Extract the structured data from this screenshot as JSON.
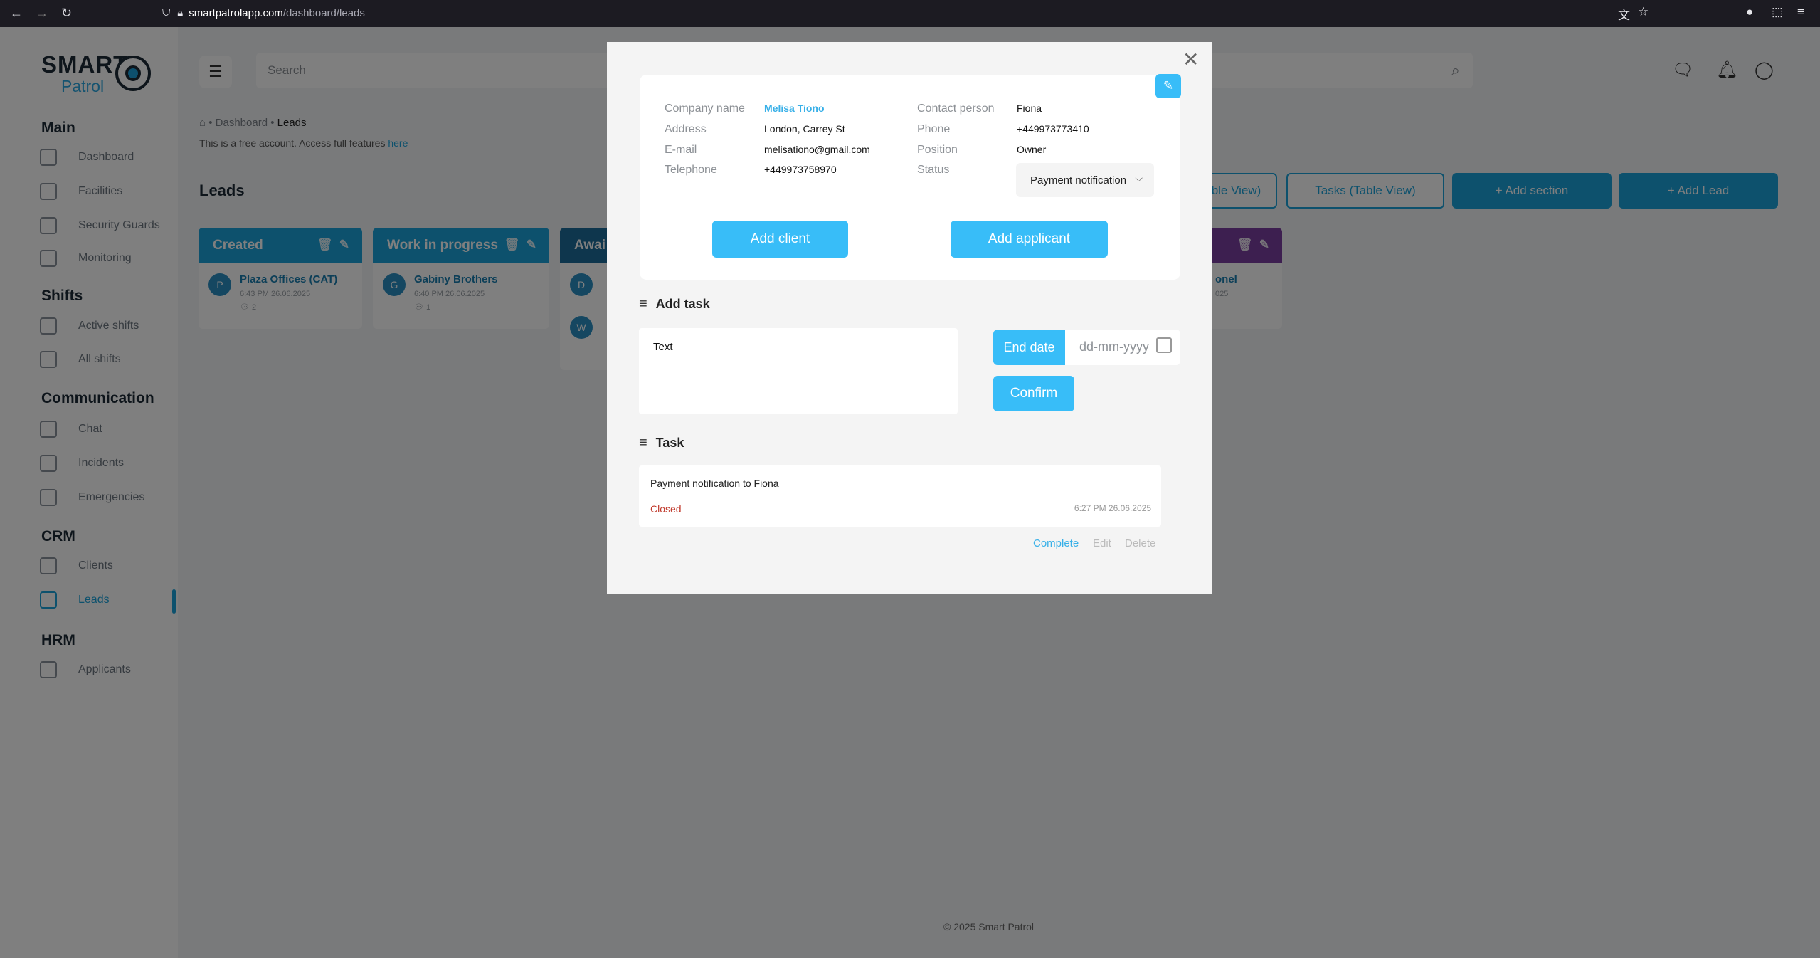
{
  "browser": {
    "url_host": "smartpatrolapp.com",
    "url_path": "/dashboard/leads"
  },
  "logo": {
    "word1": "SMART",
    "word2": "Patrol"
  },
  "sidebar": {
    "sections": [
      {
        "title": "Main",
        "items": [
          {
            "label": "Dashboard",
            "icon": "dashboard-icon"
          },
          {
            "label": "Facilities",
            "icon": "building-icon"
          },
          {
            "label": "Security Guards",
            "icon": "guard-icon"
          },
          {
            "label": "Monitoring",
            "icon": "monitor-icon"
          }
        ]
      },
      {
        "title": "Shifts",
        "items": [
          {
            "label": "Active shifts",
            "icon": "clock-user-icon"
          },
          {
            "label": "All shifts",
            "icon": "calendar-icon"
          }
        ]
      },
      {
        "title": "Communication",
        "items": [
          {
            "label": "Chat",
            "icon": "chat-icon"
          },
          {
            "label": "Incidents",
            "icon": "incident-icon"
          },
          {
            "label": "Emergencies",
            "icon": "siren-icon"
          }
        ]
      },
      {
        "title": "CRM",
        "items": [
          {
            "label": "Clients",
            "icon": "clients-icon"
          },
          {
            "label": "Leads",
            "icon": "leads-icon",
            "active": true
          }
        ]
      },
      {
        "title": "HRM",
        "items": [
          {
            "label": "Applicants",
            "icon": "applicants-icon"
          }
        ]
      }
    ]
  },
  "header": {
    "search_placeholder": "Search"
  },
  "breadcrumb": {
    "parent": "Dashboard",
    "current": "Leads"
  },
  "free_note": {
    "text": "This is a free account. Access full features ",
    "link": "here"
  },
  "page_title": "Leads",
  "actions": {
    "table_view": "ble View)",
    "tasks_view": "Tasks (Table View)",
    "add_section": "+ Add section",
    "add_lead": "+ Add Lead"
  },
  "board": {
    "columns": [
      {
        "title": "Created",
        "color": "#1aa3db",
        "card": {
          "initial": "P",
          "name": "Plaza Offices (CAT)",
          "meta": "6:43 PM 26.06.2025",
          "comments": "2"
        }
      },
      {
        "title": "Work in progress",
        "color": "#1aa3db",
        "card": {
          "initial": "G",
          "name": "Gabiny Brothers",
          "meta": "6:40 PM 26.06.2025",
          "comments": "1"
        }
      },
      {
        "title": "Awai",
        "color": "#1c6d9a",
        "card": {
          "initial": "D",
          "name": "",
          "meta": "",
          "comments": ""
        },
        "card2": {
          "initial": "W"
        }
      },
      {
        "title": "",
        "color": "#7b3fa0",
        "card": {
          "initial": "",
          "name": "onel",
          "meta": "025",
          "comments": ""
        }
      }
    ]
  },
  "footer": "© 2025 Smart Patrol",
  "modal": {
    "fields_left": [
      {
        "label": "Company name",
        "value": "Melisa Tiono"
      },
      {
        "label": "Address",
        "value": "London, Carrey St"
      },
      {
        "label": "E-mail",
        "value": "melisationo@gmail.com"
      },
      {
        "label": "Telephone",
        "value": "+449973758970"
      }
    ],
    "fields_right": [
      {
        "label": "Contact person",
        "value": "Fiona"
      },
      {
        "label": "Phone",
        "value": "+449973773410"
      },
      {
        "label": "Position",
        "value": "Owner"
      },
      {
        "label": "Status",
        "value": "Payment notification"
      }
    ],
    "add_client": "Add client",
    "add_applicant": "Add applicant",
    "add_task_title": "Add task",
    "task_text": "Text",
    "end_date_label": "End date",
    "date_placeholder": "dd-mm-yyyy",
    "confirm": "Confirm",
    "task_title": "Task",
    "task": {
      "text": "Payment notification to Fiona",
      "status": "Closed",
      "timestamp": "6:27 PM 26.06.2025"
    },
    "task_actions": {
      "complete": "Complete",
      "edit": "Edit",
      "delete": "Delete"
    }
  }
}
